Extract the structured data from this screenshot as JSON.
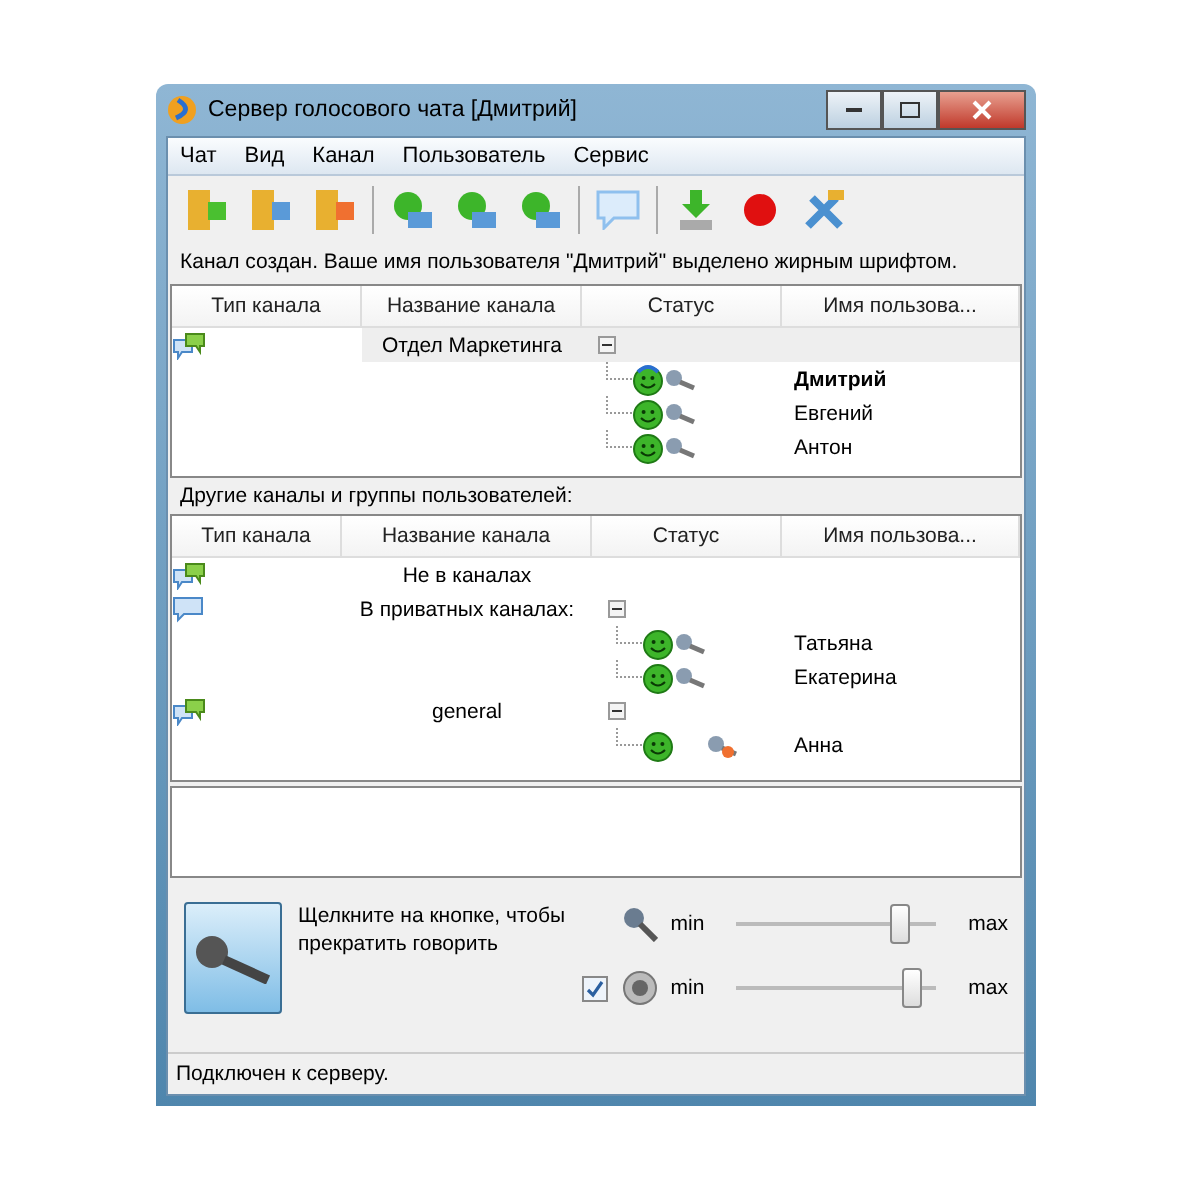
{
  "window": {
    "title": "Сервер голосового чата [Дмитрий]"
  },
  "menu": [
    "Чат",
    "Вид",
    "Канал",
    "Пользователь",
    "Сервис"
  ],
  "info": "Канал создан. Ваше имя пользователя \"Дмитрий\" выделено жирным шрифтом.",
  "table_1": {
    "columns": [
      "Тип канала",
      "Название канала",
      "Статус",
      "Имя пользова..."
    ],
    "channels": [
      {
        "name": "Отдел Маркетинга",
        "kind": "public",
        "selected": true,
        "expanded": true,
        "users": [
          {
            "name": "Дмитрий",
            "self": true,
            "operator": true,
            "mic_off": false
          },
          {
            "name": "Евгений",
            "self": false,
            "operator": false,
            "mic_off": false
          },
          {
            "name": "Антон",
            "self": false,
            "operator": false,
            "mic_off": false
          }
        ]
      }
    ]
  },
  "others_label": "Другие каналы и группы пользователей:",
  "table_2": {
    "columns": [
      "Тип канала",
      "Название канала",
      "Статус",
      "Имя пользова..."
    ],
    "channels": [
      {
        "name": "Не в каналах",
        "kind": "public",
        "selected": false
      },
      {
        "name": "В приватных каналах:",
        "kind": "private",
        "selected": false,
        "expanded": true,
        "users": [
          {
            "name": "Татьяна",
            "self": false,
            "operator": false,
            "mic_off": false
          },
          {
            "name": "Екатерина",
            "self": false,
            "operator": false,
            "mic_off": false
          }
        ]
      },
      {
        "name": "general",
        "kind": "public",
        "selected": false,
        "expanded": true,
        "users": [
          {
            "name": "Анна",
            "self": false,
            "operator": false,
            "mic_off": true
          }
        ]
      }
    ]
  },
  "hint": "Щелкните на кнопке, чтобы прекратить говорить",
  "sliders": [
    {
      "kind": "mic",
      "min": "min",
      "max": "max",
      "level": 0.82
    },
    {
      "kind": "speaker",
      "checked": true,
      "min": "min",
      "max": "max",
      "level": 0.88
    }
  ],
  "status_bar": "Подключен к серверу."
}
